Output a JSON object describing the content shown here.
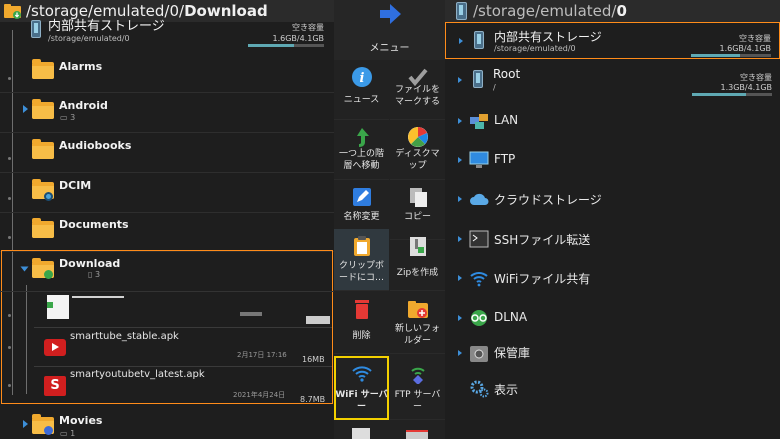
{
  "left": {
    "path_prefix": "/storage/emulated/0/",
    "path_current": "Download",
    "storage": {
      "name": "内部共有ストレージ",
      "path": "/storage/emulated/0",
      "free_label": "空き容量",
      "free_value": "1.6GB/4.1GB",
      "usage_fraction": 0.61
    },
    "folders": [
      {
        "name": "Alarms",
        "sub": ""
      },
      {
        "name": "Android",
        "sub": "3"
      },
      {
        "name": "Audiobooks",
        "sub": ""
      },
      {
        "name": "DCIM",
        "sub": ""
      },
      {
        "name": "Documents",
        "sub": ""
      },
      {
        "name": "Download",
        "sub": "3"
      },
      {
        "name": "Movies",
        "sub": "1"
      }
    ],
    "files": [
      {
        "name": "smarttube_stable.apk",
        "date": "2月17日 17:16",
        "size": "16MB"
      },
      {
        "name": "smartyoutubetv_latest.apk",
        "date": "2021年4月24日",
        "size": "8.7MB"
      }
    ]
  },
  "menu": {
    "title": "メニュー",
    "items": [
      {
        "label": "ニュース",
        "icon": "info-icon"
      },
      {
        "label": "ファイルを\nマークする",
        "icon": "checkmark-icon"
      },
      {
        "label": "一つ上の階\n層へ移動",
        "icon": "up-arrow-icon"
      },
      {
        "label": "ディスクマ\nップ",
        "icon": "pie-chart-icon"
      },
      {
        "label": "名称変更",
        "icon": "rename-icon"
      },
      {
        "label": "コピー",
        "icon": "copy-icon"
      },
      {
        "label": "クリップボ\nードにコ…",
        "icon": "clipboard-icon"
      },
      {
        "label": "Zipを作成",
        "icon": "zip-icon"
      },
      {
        "label": "削除",
        "icon": "trash-icon"
      },
      {
        "label": "新しいフォ\nルダー",
        "icon": "new-folder-icon"
      },
      {
        "label": "WiFi サーバ\nー",
        "icon": "wifi-icon"
      },
      {
        "label": "FTP サーバ\nー",
        "icon": "ftp-server-icon"
      }
    ]
  },
  "right": {
    "path_prefix": "/storage/emulated/",
    "path_current": "0",
    "storages": [
      {
        "name": "内部共有ストレージ",
        "path": "/storage/emulated/0",
        "free_label": "空き容量",
        "free_value": "1.6GB/4.1GB",
        "usage_fraction": 0.61
      },
      {
        "name": "Root",
        "path": "/",
        "free_label": "空き容量",
        "free_value": "1.3GB/4.1GB",
        "usage_fraction": 0.68
      }
    ],
    "items": [
      {
        "label": "LAN",
        "icon": "lan-icon"
      },
      {
        "label": "FTP",
        "icon": "monitor-icon"
      },
      {
        "label": "クラウドストレージ",
        "icon": "cloud-icon"
      },
      {
        "label": "SSHファイル転送",
        "icon": "terminal-icon"
      },
      {
        "label": "WiFiファイル共有",
        "icon": "wifi-icon"
      },
      {
        "label": "DLNA",
        "icon": "dlna-icon"
      },
      {
        "label": "保管庫",
        "icon": "vault-icon"
      },
      {
        "label": "表示",
        "icon": "settings-icon"
      }
    ]
  },
  "colors": {
    "accent_orange": "#ff8c1a",
    "focus_yellow": "#f3d000",
    "folder": "#f0a92e",
    "link_blue": "#3d8fd8"
  }
}
